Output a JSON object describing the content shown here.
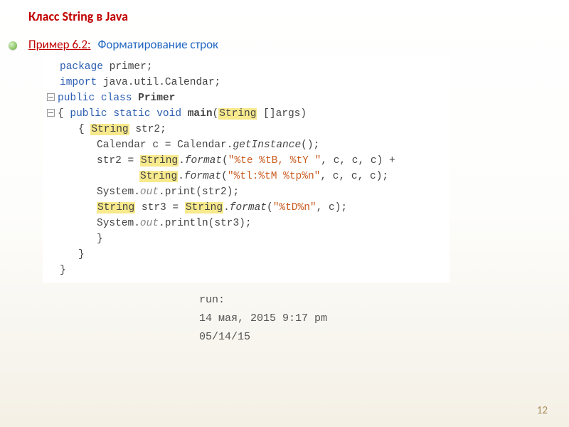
{
  "header": "Класс String в Java",
  "example_label": "Пример 6.2:",
  "example_title": "Форматирование строк",
  "code": {
    "l1a": "package",
    "l1b": " primer;",
    "l2a": "import",
    "l2b": " java.util.Calendar;",
    "l3a": "public class ",
    "l3b": "Primer",
    "l4a": "{ ",
    "l4b": "public static void ",
    "l4c": "main",
    "l4d": "(",
    "l4e": "String",
    "l4f": " []args)",
    "l5a": "{ ",
    "l5b": "String",
    "l5c": " str2;",
    "l6a": "Calendar c = Calendar.",
    "l6b": "getInstance",
    "l6c": "();",
    "l7a": "str2 = ",
    "l7b": "String",
    "l7c": ".",
    "l7d": "format",
    "l7e": "(",
    "l7f": "\"%te %tB, %tY \"",
    "l7g": ", c, c, c) +",
    "l8b": "String",
    "l8c": ".",
    "l8d": "format",
    "l8e": "(",
    "l8f": "\"%tl:%tM %tp%n\"",
    "l8g": ", c, c, c);",
    "l9a": "System.",
    "l9b": "out",
    "l9c": ".print(str2);",
    "l10b": "String",
    "l10c": " str3 = ",
    "l10d": "String",
    "l10e": ".",
    "l10f": "format",
    "l10g": "(",
    "l10h": "\"%tD%n\"",
    "l10i": ", c);",
    "l11a": "System.",
    "l11b": "out",
    "l11c": ".println(str3);",
    "l12": "}",
    "l13": "}",
    "l14": "}"
  },
  "run": {
    "label": "run:",
    "line1": "14 мая, 2015 9:17 pm",
    "line2": "05/14/15"
  },
  "page_number": "12"
}
